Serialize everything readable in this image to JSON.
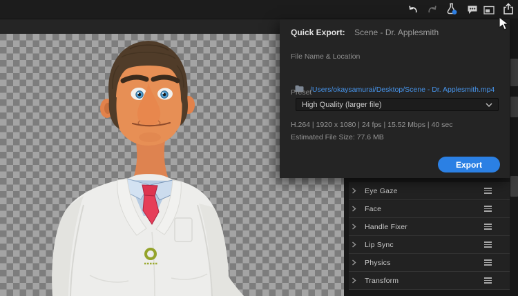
{
  "toolbar": {
    "icons": [
      {
        "name": "undo-icon"
      },
      {
        "name": "redo-icon"
      },
      {
        "name": "lab-flask-icon",
        "badge_color": "#2f82e8"
      },
      {
        "name": "feedback-bubble-icon"
      },
      {
        "name": "picture-in-picture-icon"
      },
      {
        "name": "share-export-icon"
      }
    ]
  },
  "quick_export": {
    "title": "Quick Export:",
    "scene_name": "Scene - Dr. Applesmith",
    "file_section_label": "File Name & Location",
    "file_path": "/Users/okaysamurai/Desktop/Scene - Dr. Applesmith.mp4",
    "preset_label": "Preset",
    "preset_value": "High Quality (larger file)",
    "format_summary": "H.264 | 1920 x 1080 | 24 fps | 15.52 Mbps | 40 sec",
    "estimated_size": "Estimated File Size: 77.6 MB",
    "export_button": "Export",
    "colors": {
      "accent": "#2b80e4",
      "link": "#4795ec"
    }
  },
  "behaviors": {
    "items": [
      {
        "label": "Eye Gaze"
      },
      {
        "label": "Face"
      },
      {
        "label": "Handle Fixer"
      },
      {
        "label": "Lip Sync"
      },
      {
        "label": "Physics"
      },
      {
        "label": "Transform"
      }
    ]
  },
  "canvas": {
    "checker_light": "#a4a4a4",
    "checker_dark": "#7d7d7d",
    "character": "claymation scientist puppet"
  }
}
